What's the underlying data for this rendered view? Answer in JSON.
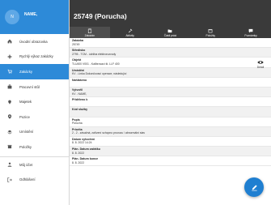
{
  "user": {
    "initials": "N",
    "name": "NAME,"
  },
  "nav": [
    {
      "label": "Úvodní obrazovka",
      "icon": "home-icon"
    },
    {
      "label": "Rychlý výkaz zakázky",
      "icon": "plus-icon"
    },
    {
      "label": "Zakázky",
      "icon": "cart-icon"
    },
    {
      "label": "Pracovní stůl",
      "icon": "desk-icon"
    },
    {
      "label": "Majetek",
      "icon": "pin-icon"
    },
    {
      "label": "Pozice",
      "icon": "location-icon"
    },
    {
      "label": "Umístění",
      "icon": "layers-icon"
    },
    {
      "label": "Položky",
      "icon": "box-icon"
    },
    {
      "label": "Můj účet",
      "icon": "user-icon"
    },
    {
      "label": "Odhlášení",
      "icon": "logout-icon"
    }
  ],
  "title": "25749 (Porucha)",
  "tabs": [
    {
      "label": "Zakázkn",
      "icon": "clipboard-icon"
    },
    {
      "label": "Aktivity",
      "icon": "hammer-icon"
    },
    {
      "label": "Části práci",
      "icon": "folder-icon"
    },
    {
      "label": "Položky",
      "icon": "box-icon"
    },
    {
      "label": "Poznámky",
      "icon": "chat-icon"
    }
  ],
  "fields": [
    {
      "label": "Zakázka",
      "value": "25749"
    },
    {
      "label": "Středisko",
      "value": "2795 - TCM - údržba elektrorozvody"
    },
    {
      "label": "Objekt",
      "value": "TLU400 V001 - Kalibrovací št. LLF 400"
    },
    {
      "label": "Umístění",
      "value": "KV - Linka Dokončovací operace, následující"
    },
    {
      "label": "Nahlášeno",
      "value": ""
    },
    {
      "label": "Vytvořil",
      "value": "KV - NAME,"
    },
    {
      "label": "Přiděleno k",
      "value": ""
    },
    {
      "label": "Kód služby",
      "value": ""
    },
    {
      "label": "Popis",
      "value": "Porucha"
    },
    {
      "label": "Priorita",
      "value": "2 - 2 - závažná, zařízení schopno provozu / abnormální stav"
    },
    {
      "label": "Datum vytvoření",
      "value": "8. 8. 2022 14:24"
    },
    {
      "label": "Plán. Datum začátku",
      "value": "8. 8. 2022"
    },
    {
      "label": "Plán. Datum konce",
      "value": "8. 8. 2022"
    }
  ],
  "detail_label": "Detail",
  "colors": {
    "accent": "#2d8ad8",
    "topbar": "#3a3a3a",
    "fab": "#1f7fd1"
  }
}
